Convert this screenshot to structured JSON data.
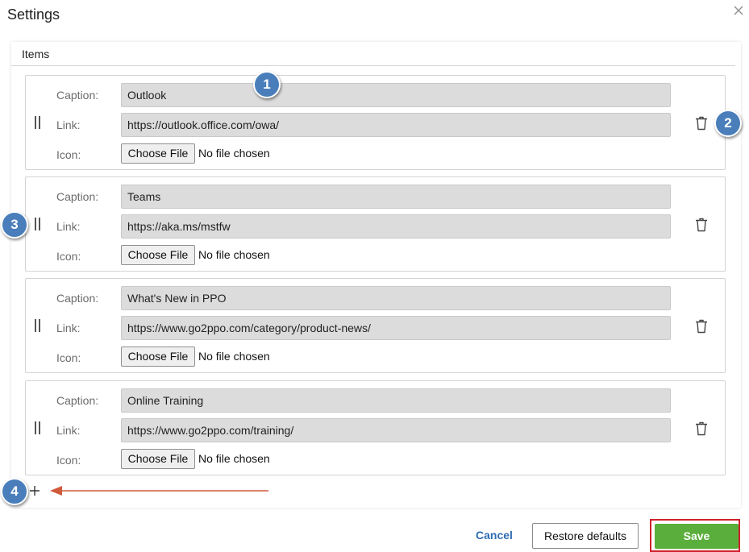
{
  "dialog": {
    "title": "Settings"
  },
  "section": {
    "title": "Items"
  },
  "labels": {
    "caption": "Caption:",
    "link": "Link:",
    "icon": "Icon:"
  },
  "items": [
    {
      "caption": "Outlook",
      "link": "https://outlook.office.com/owa/",
      "file_button": "Choose File",
      "file_status": "No file chosen"
    },
    {
      "caption": "Teams",
      "link": "https://aka.ms/mstfw",
      "file_button": "Choose File",
      "file_status": "No file chosen"
    },
    {
      "caption": "What's New in PPO",
      "link": "https://www.go2ppo.com/category/product-news/",
      "file_button": "Choose File",
      "file_status": "No file chosen"
    },
    {
      "caption": "Online Training",
      "link": "https://www.go2ppo.com/training/",
      "file_button": "Choose File",
      "file_status": "No file chosen"
    }
  ],
  "callouts": [
    "1",
    "2",
    "3",
    "4"
  ],
  "footer": {
    "cancel": "Cancel",
    "restore": "Restore defaults",
    "save": "Save"
  },
  "colors": {
    "badge": "#4a7ebb",
    "arrow": "#d05a3c",
    "save": "#5aae3c",
    "highlight": "#d0202a",
    "link": "#2f6db5"
  },
  "icons": {
    "close": "close-icon",
    "drag": "drag-handle-icon",
    "delete": "trash-icon",
    "add": "plus-icon"
  }
}
